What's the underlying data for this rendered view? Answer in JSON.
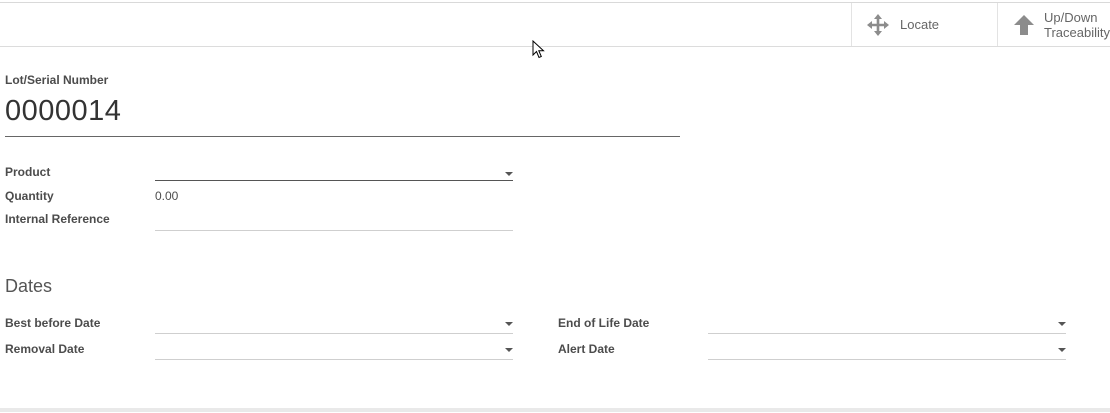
{
  "buttons": {
    "locate": {
      "label": "Locate",
      "icon": "arrows-move-icon"
    },
    "traceability": {
      "label_line1": "Up/Down",
      "label_line2": "Traceability",
      "icon": "arrow-up-icon"
    }
  },
  "form": {
    "lot_label": "Lot/Serial Number",
    "lot_value": "0000014",
    "product_label": "Product",
    "product_value": "",
    "quantity_label": "Quantity",
    "quantity_value": "0.00",
    "internal_ref_label": "Internal Reference",
    "internal_ref_value": ""
  },
  "dates": {
    "section_title": "Dates",
    "best_before_label": "Best before Date",
    "removal_label": "Removal Date",
    "end_of_life_label": "End of Life Date",
    "alert_label": "Alert Date"
  },
  "colors": {
    "text": "#4c4c4c",
    "icon": "#8c8c8c"
  }
}
